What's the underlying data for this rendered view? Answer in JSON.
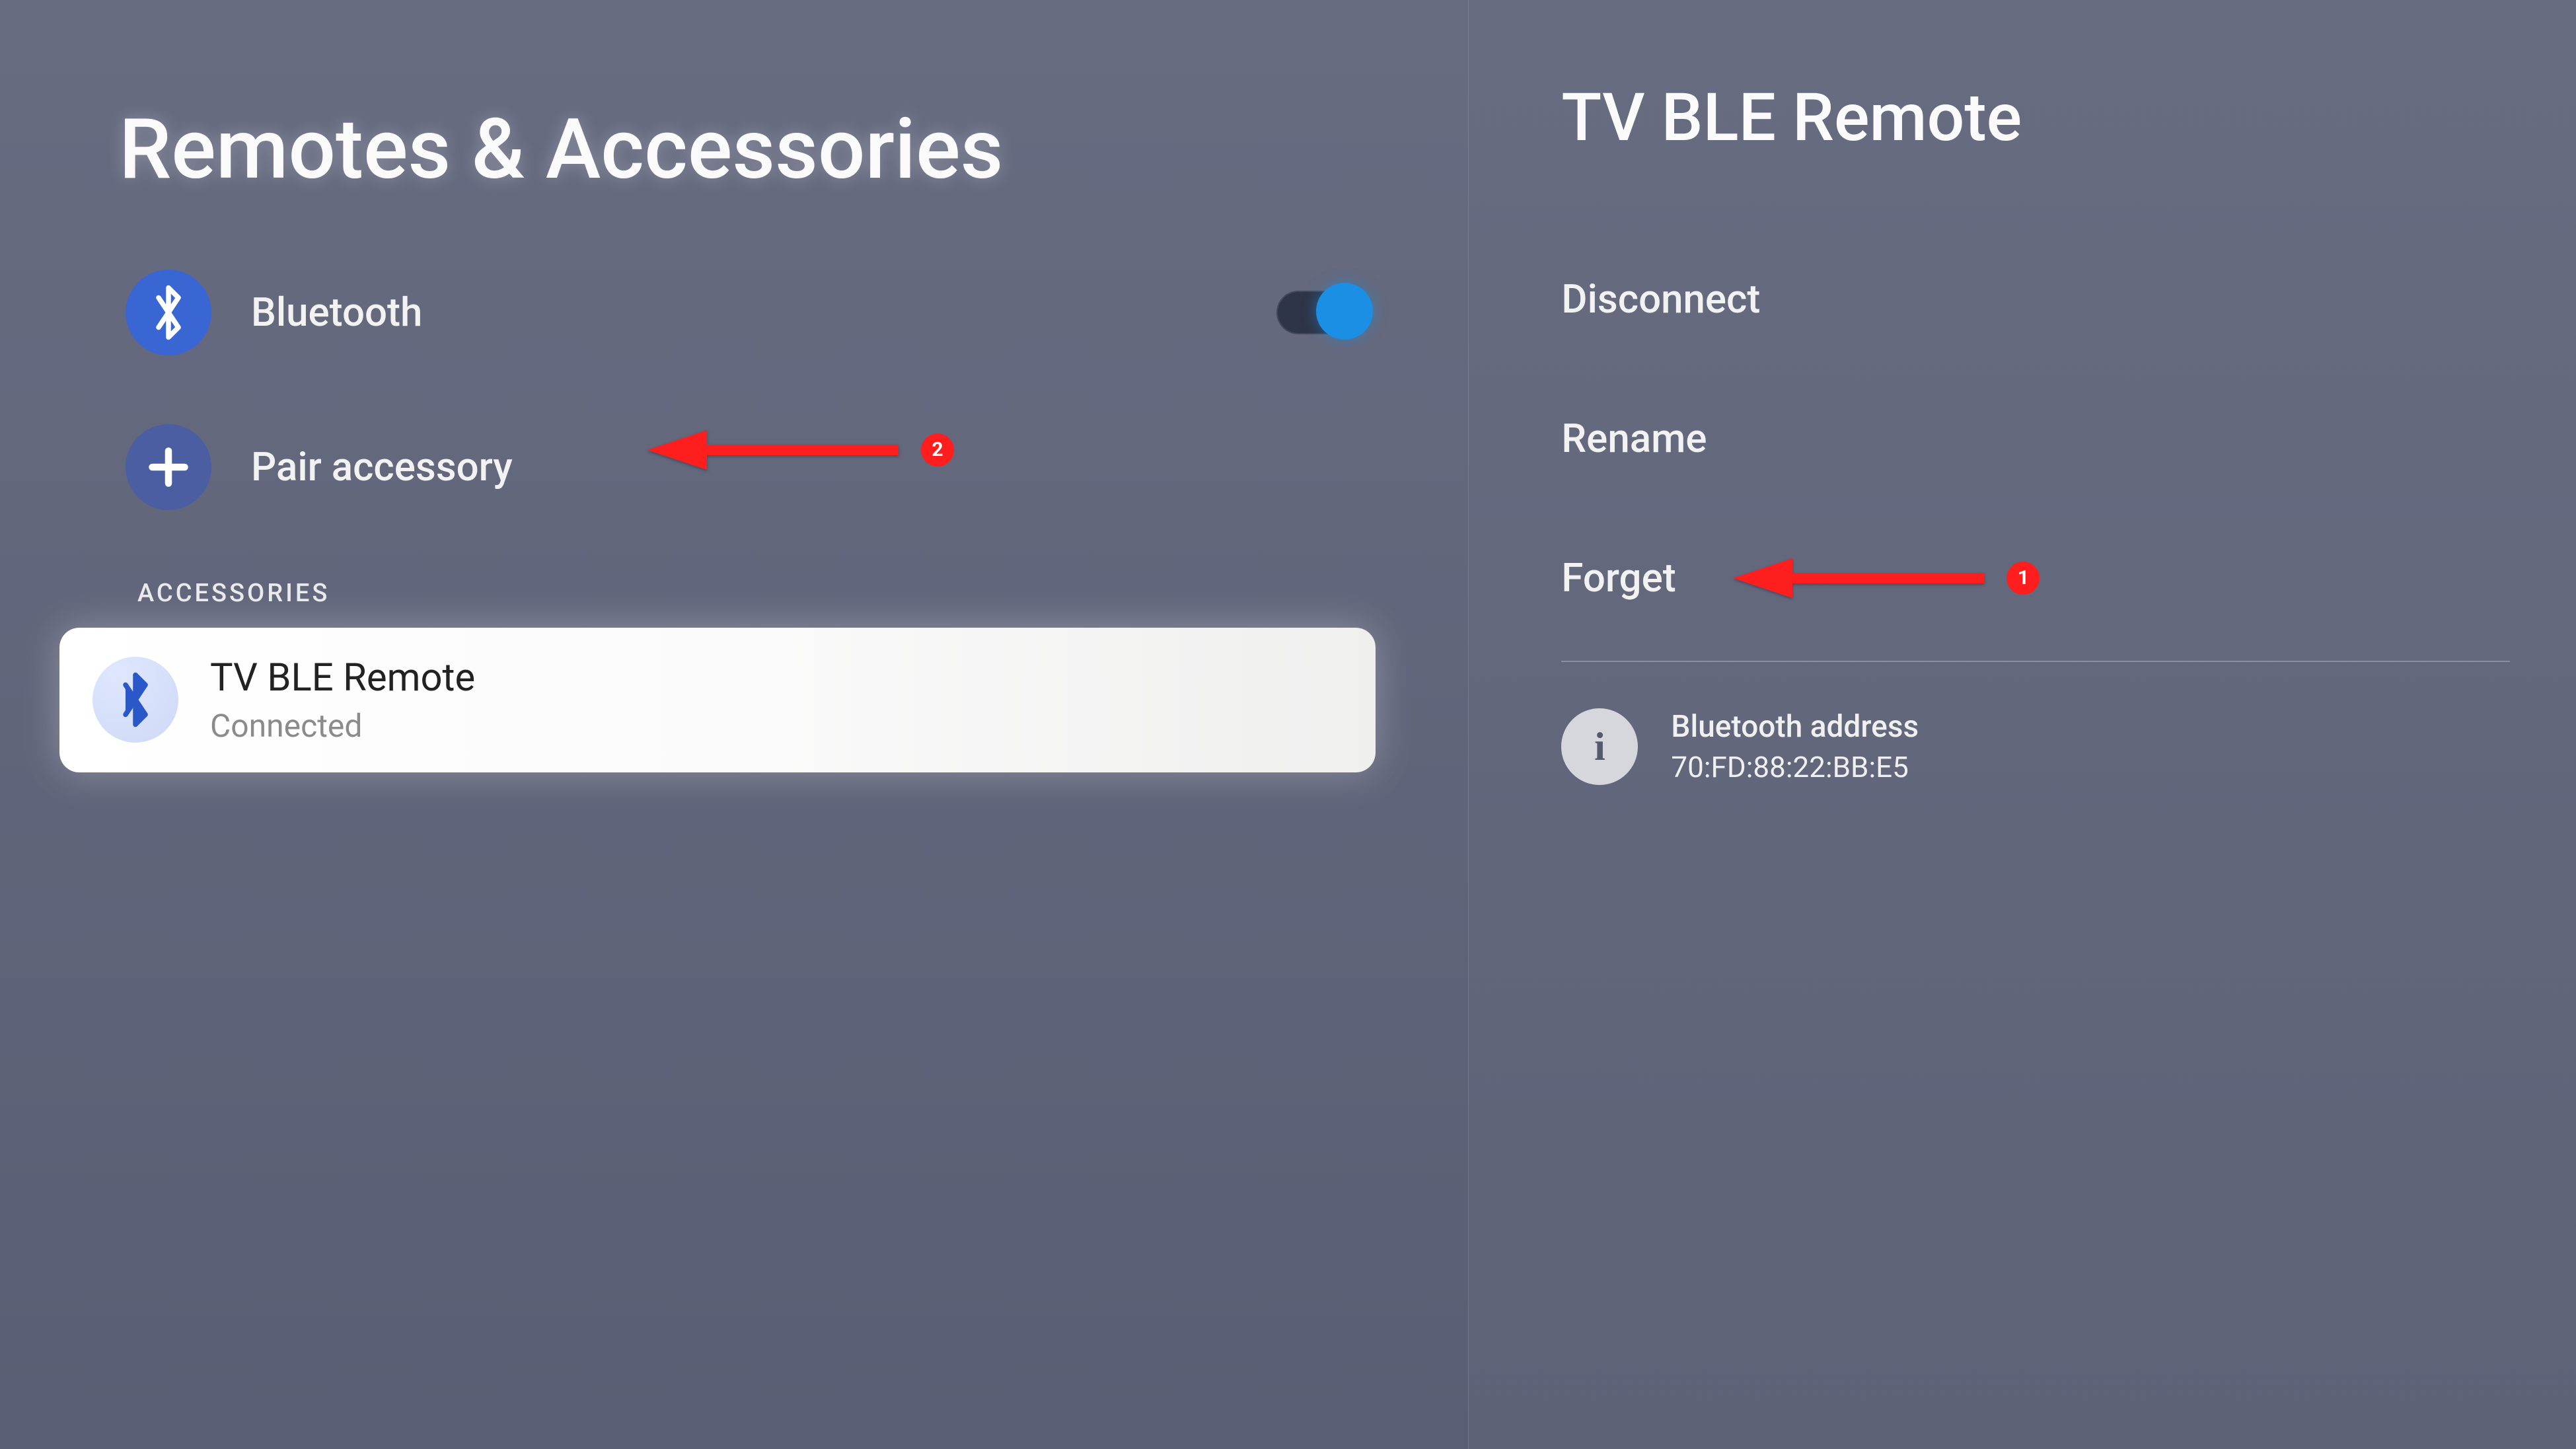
{
  "left": {
    "title": "Remotes & Accessories",
    "bluetooth_label": "Bluetooth",
    "bluetooth_on": true,
    "pair_label": "Pair accessory",
    "section_label": "ACCESSORIES",
    "device": {
      "name": "TV BLE Remote",
      "status": "Connected"
    }
  },
  "right": {
    "title": "TV BLE Remote",
    "options": {
      "disconnect": "Disconnect",
      "rename": "Rename",
      "forget": "Forget"
    },
    "info": {
      "label": "Bluetooth address",
      "value": "70:FD:88:22:BB:E5"
    }
  },
  "annotations": {
    "a1": "1",
    "a2": "2"
  }
}
